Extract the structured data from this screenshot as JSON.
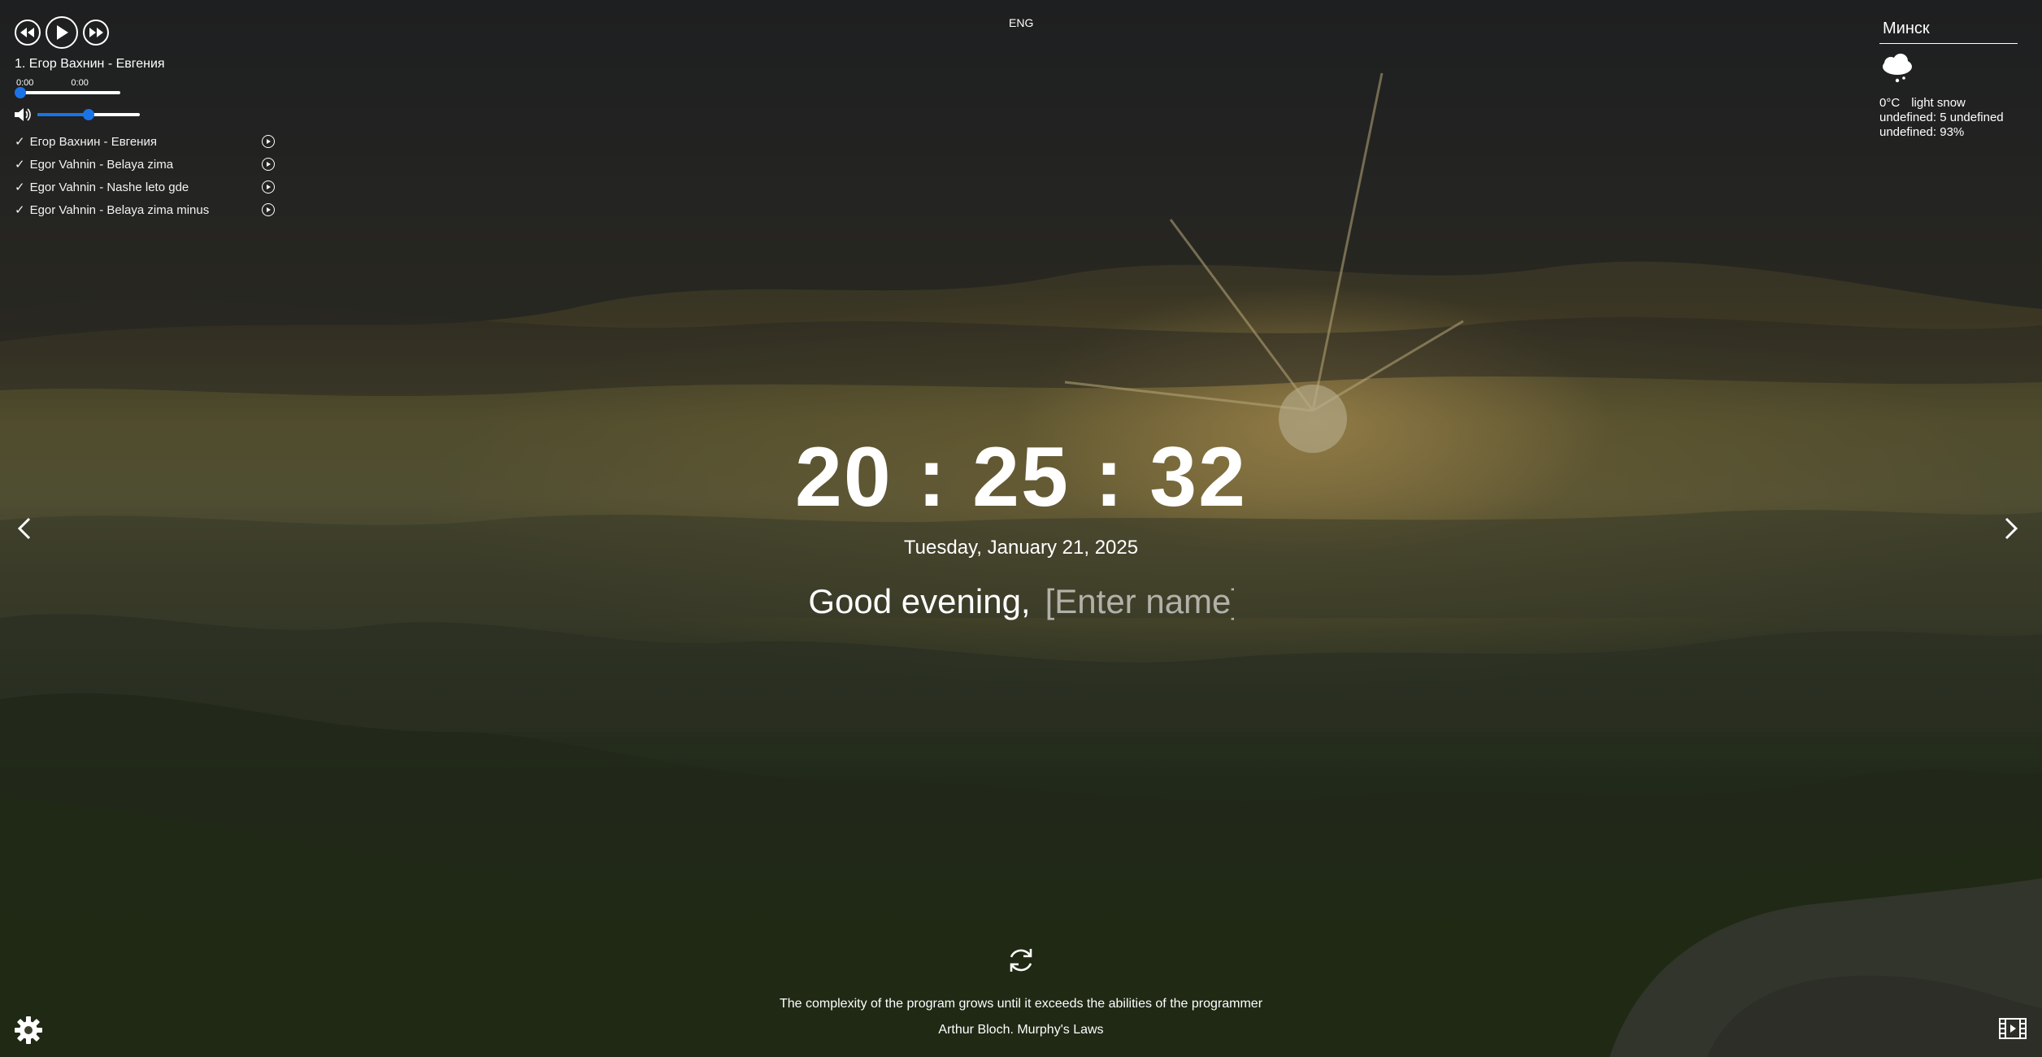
{
  "player": {
    "current_track": "1. Егор Вахнин - Евгения",
    "time_current": "0:00",
    "time_total": "0:00",
    "progress_fraction": 0.0,
    "volume_fraction": 0.5,
    "playlist": [
      {
        "check": "✓",
        "title": "Егор Вахнин - Евгения"
      },
      {
        "check": "✓",
        "title": "Egor Vahnin - Belaya zima"
      },
      {
        "check": "✓",
        "title": "Egor Vahnin - Nashe leto gde"
      },
      {
        "check": "✓",
        "title": "Egor Vahnin - Belaya zima minus"
      }
    ]
  },
  "language": {
    "label": "ENG"
  },
  "weather": {
    "city": "Минск",
    "icon": "cloud-snow-icon",
    "temperature": "0°C",
    "description": "light snow",
    "wind": "undefined: 5 undefined",
    "humidity": "undefined: 93%"
  },
  "clock": {
    "time": "20 : 25 : 32",
    "date": "Tuesday, January 21, 2025"
  },
  "greeting": {
    "text": "Good evening,",
    "name_placeholder": "[Enter name]",
    "name_value": ""
  },
  "quote": {
    "text": "The complexity of the program grows until it exceeds the abilities of the programmer",
    "author": "Arthur Bloch. Murphy's Laws"
  },
  "colors": {
    "accent": "#1a73e8",
    "text": "#ffffff"
  }
}
